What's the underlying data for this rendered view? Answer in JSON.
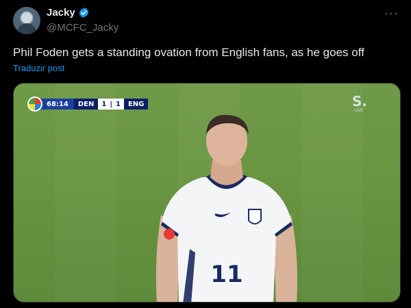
{
  "author": {
    "display_name": "Jacky",
    "handle": "@MCFC_Jacky",
    "verified": true
  },
  "more_label": "···",
  "tweet": {
    "text": "Phil Foden gets a standing ovation from English fans, as he goes off",
    "translate_label": "Traduzir post"
  },
  "media": {
    "scorebug": {
      "time": "68:14",
      "home_team": "DEN",
      "home_score": "1",
      "away_score": "1",
      "away_team": "ENG"
    },
    "channel_logo": "S.",
    "channel_sub": "LIVE",
    "shirt_number": "11"
  },
  "colors": {
    "background": "#000000",
    "link": "#1d9bf0",
    "secondary_text": "#71767b",
    "pitch": "#6a9642"
  }
}
